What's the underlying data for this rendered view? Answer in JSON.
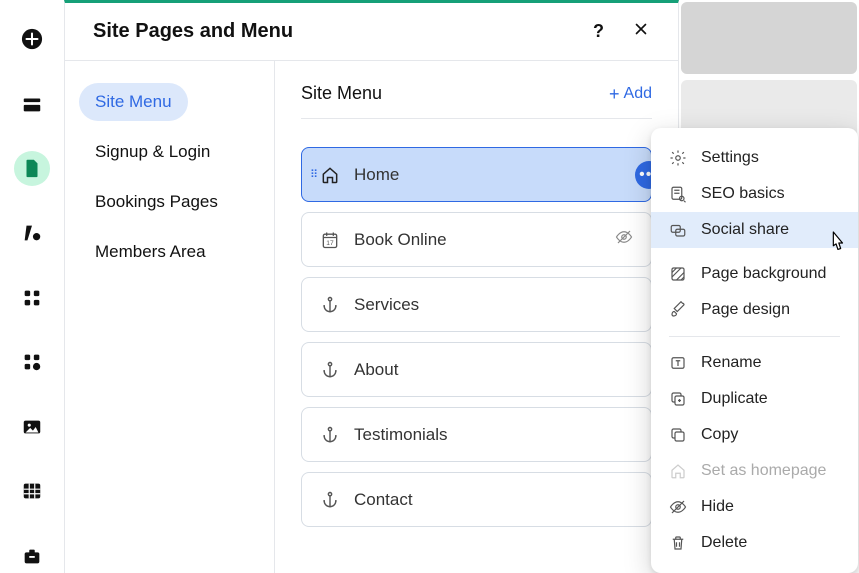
{
  "panel": {
    "title": "Site Pages and Menu"
  },
  "sidebar": {
    "items": [
      {
        "label": "Site Menu"
      },
      {
        "label": "Signup & Login"
      },
      {
        "label": "Bookings Pages"
      },
      {
        "label": "Members Area"
      }
    ]
  },
  "section": {
    "title": "Site Menu",
    "add_label": "Add"
  },
  "pages": [
    {
      "label": "Home",
      "icon": "home",
      "selected": true
    },
    {
      "label": "Book Online",
      "icon": "calendar",
      "hidden": true
    },
    {
      "label": "Services",
      "icon": "anchor"
    },
    {
      "label": "About",
      "icon": "anchor"
    },
    {
      "label": "Testimonials",
      "icon": "anchor"
    },
    {
      "label": "Contact",
      "icon": "anchor"
    }
  ],
  "context_menu": {
    "items": [
      {
        "label": "Settings",
        "icon": "gear"
      },
      {
        "label": "SEO basics",
        "icon": "search-doc"
      },
      {
        "label": "Social share",
        "icon": "share-frames",
        "hover": true
      },
      {
        "gap": true
      },
      {
        "label": "Page background",
        "icon": "hatch"
      },
      {
        "label": "Page design",
        "icon": "brush"
      },
      {
        "divider": true
      },
      {
        "label": "Rename",
        "icon": "text-frame"
      },
      {
        "label": "Duplicate",
        "icon": "duplicate"
      },
      {
        "label": "Copy",
        "icon": "copy"
      },
      {
        "label": "Set as homepage",
        "icon": "home",
        "disabled": true
      },
      {
        "label": "Hide",
        "icon": "eye-off"
      },
      {
        "label": "Delete",
        "icon": "trash"
      }
    ]
  }
}
